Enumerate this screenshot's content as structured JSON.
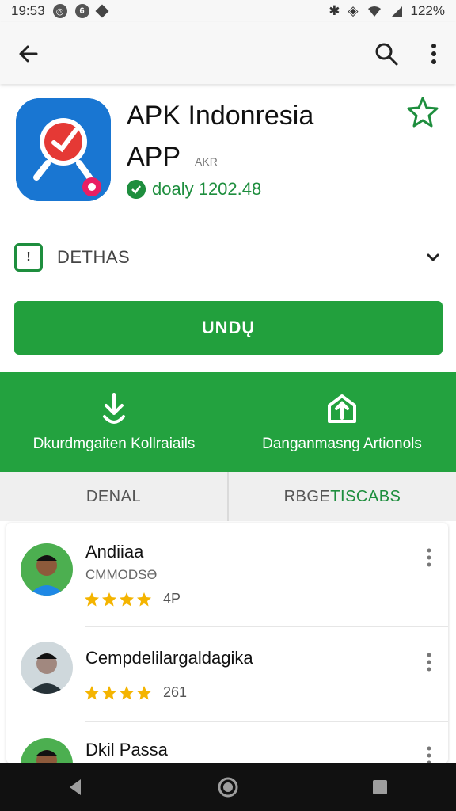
{
  "status_bar": {
    "time": "19:53",
    "notif_1": "Ò",
    "notif_2": "Ó",
    "battery": "122%"
  },
  "app_bar": {
    "back_icon": "arrow-left-icon",
    "search_icon": "search-icon",
    "more_icon": "more-vert-icon"
  },
  "app": {
    "title_line1": "APK Indonresia",
    "title_line2": "APP",
    "subtitle": "AKR",
    "rating_text": "doaly 1202.48",
    "wishlist_icon": "star-outline-icon"
  },
  "details": {
    "icon_text": "!",
    "label": "DETHAS"
  },
  "install": {
    "label": "UNDŲ"
  },
  "actions": [
    {
      "label": "Dkurdmgaiten Kollraiails",
      "icon": "download-icon"
    },
    {
      "label": "Danganmasng Artionols",
      "icon": "share-up-icon"
    }
  ],
  "tabs": {
    "tab1": "DENAL",
    "tab2_a": "RBGE",
    "tab2_b": "TISCABS"
  },
  "reviews": [
    {
      "name": "Andiiaa",
      "meta": "CMMODSƏ",
      "stars": 4,
      "score": "4P"
    },
    {
      "name": "Cempdelilargaldagika",
      "meta": "",
      "stars": 4,
      "score": "261"
    },
    {
      "name": "Dkil Passa",
      "meta": "",
      "stars": 0,
      "score": ""
    }
  ],
  "colors": {
    "green": "#23a23f",
    "dark_green": "#1e8e3e",
    "blue": "#1976d2",
    "star": "#f4b400"
  }
}
